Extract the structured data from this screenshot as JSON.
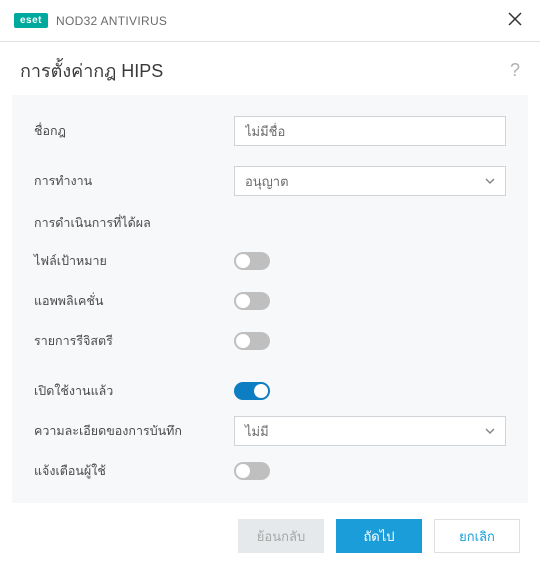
{
  "titlebar": {
    "brand_badge": "eset",
    "brand_text": "NOD32 ANTIVIRUS"
  },
  "heading": "การตั้งค่ากฎ HIPS",
  "help_symbol": "?",
  "fields": {
    "rule_name_label": "ชื่อกฎ",
    "rule_name_value": "ไม่มีชื่อ",
    "action_label": "การทำงาน",
    "action_value": "อนุญาต"
  },
  "section_ops_label": "การดำเนินการที่ได้ผล",
  "ops": {
    "target_files_label": "ไฟล์เป้าหมาย",
    "target_files_on": false,
    "applications_label": "แอพพลิเคชั่น",
    "applications_on": false,
    "registry_label": "รายการรีจิสตรี",
    "registry_on": false
  },
  "extra": {
    "enabled_label": "เปิดใช้งานแล้ว",
    "enabled_on": true,
    "log_detail_label": "ความละเอียดของการบันทึก",
    "log_detail_value": "ไม่มี",
    "notify_label": "แจ้งเตือนผู้ใช้",
    "notify_on": false
  },
  "footer": {
    "back": "ย้อนกลับ",
    "next": "ถัดไป",
    "cancel": "ยกเลิก"
  }
}
